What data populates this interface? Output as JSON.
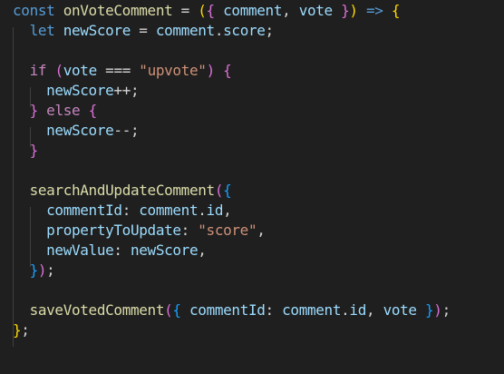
{
  "editor": {
    "theme": {
      "background": "#1f1f1f",
      "keyword": "#569cd6",
      "control": "#c586c0",
      "function": "#dcdcaa",
      "variable": "#9cdcfe",
      "string": "#ce9178",
      "bracket_1": "#ffd700",
      "bracket_2": "#da70d6",
      "bracket_3": "#179fff"
    },
    "lines": [
      [
        [
          "kw",
          "const "
        ],
        [
          "fn",
          "onVoteComment"
        ],
        [
          "pun",
          " = "
        ],
        [
          "b1",
          "("
        ],
        [
          "b2",
          "{"
        ],
        [
          "var",
          " comment"
        ],
        [
          "pun",
          ", "
        ],
        [
          "var",
          "vote "
        ],
        [
          "b2",
          "}"
        ],
        [
          "b1",
          ")"
        ],
        [
          "kw",
          " =>"
        ],
        [
          "pun",
          " "
        ],
        [
          "b1",
          "{"
        ]
      ],
      [
        [
          "pun",
          "  "
        ],
        [
          "kw",
          "let "
        ],
        [
          "var",
          "newScore"
        ],
        [
          "pun",
          " = "
        ],
        [
          "var",
          "comment"
        ],
        [
          "pun",
          "."
        ],
        [
          "var",
          "score"
        ],
        [
          "pun",
          ";"
        ]
      ],
      [],
      [
        [
          "pun",
          "  "
        ],
        [
          "ctrl",
          "if "
        ],
        [
          "b2",
          "("
        ],
        [
          "var",
          "vote"
        ],
        [
          "pun",
          " === "
        ],
        [
          "str",
          "\"upvote\""
        ],
        [
          "b2",
          ")"
        ],
        [
          "pun",
          " "
        ],
        [
          "b2",
          "{"
        ]
      ],
      [
        [
          "pun",
          "    "
        ],
        [
          "var",
          "newScore"
        ],
        [
          "pun",
          "++;"
        ]
      ],
      [
        [
          "pun",
          "  "
        ],
        [
          "b2",
          "}"
        ],
        [
          "pun",
          " "
        ],
        [
          "ctrl",
          "else "
        ],
        [
          "b2",
          "{"
        ]
      ],
      [
        [
          "pun",
          "    "
        ],
        [
          "var",
          "newScore"
        ],
        [
          "pun",
          "--;"
        ]
      ],
      [
        [
          "pun",
          "  "
        ],
        [
          "b2",
          "}"
        ]
      ],
      [],
      [
        [
          "pun",
          "  "
        ],
        [
          "fn",
          "searchAndUpdateComment"
        ],
        [
          "b2",
          "("
        ],
        [
          "b3",
          "{"
        ]
      ],
      [
        [
          "pun",
          "    "
        ],
        [
          "var",
          "commentId"
        ],
        [
          "pun",
          ": "
        ],
        [
          "var",
          "comment"
        ],
        [
          "pun",
          "."
        ],
        [
          "var",
          "id"
        ],
        [
          "pun",
          ","
        ]
      ],
      [
        [
          "pun",
          "    "
        ],
        [
          "var",
          "propertyToUpdate"
        ],
        [
          "pun",
          ": "
        ],
        [
          "str",
          "\"score\""
        ],
        [
          "pun",
          ","
        ]
      ],
      [
        [
          "pun",
          "    "
        ],
        [
          "var",
          "newValue"
        ],
        [
          "pun",
          ": "
        ],
        [
          "var",
          "newScore"
        ],
        [
          "pun",
          ","
        ]
      ],
      [
        [
          "pun",
          "  "
        ],
        [
          "b3",
          "}"
        ],
        [
          "b2",
          ")"
        ],
        [
          "pun",
          ";"
        ]
      ],
      [],
      [
        [
          "pun",
          "  "
        ],
        [
          "fn",
          "saveVotedComment"
        ],
        [
          "b2",
          "("
        ],
        [
          "b3",
          "{"
        ],
        [
          "pun",
          " "
        ],
        [
          "var",
          "commentId"
        ],
        [
          "pun",
          ": "
        ],
        [
          "var",
          "comment"
        ],
        [
          "pun",
          "."
        ],
        [
          "var",
          "id"
        ],
        [
          "pun",
          ", "
        ],
        [
          "var",
          "vote"
        ],
        [
          "pun",
          " "
        ],
        [
          "b3",
          "}"
        ],
        [
          "b2",
          ")"
        ],
        [
          "pun",
          ";"
        ]
      ],
      [
        [
          "b1",
          "}"
        ],
        [
          "pun",
          ";"
        ]
      ]
    ]
  }
}
